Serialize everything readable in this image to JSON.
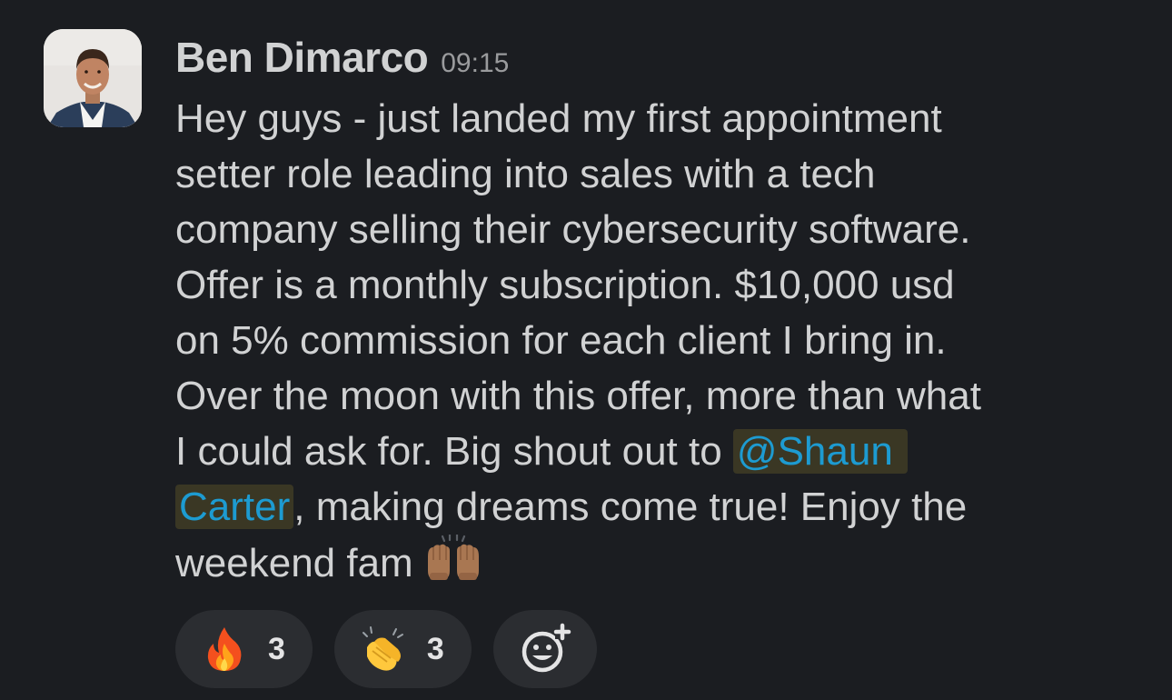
{
  "message": {
    "author": "Ben Dimarco",
    "time": "09:15",
    "text_before_mention": "Hey guys - just landed my first appointment\nsetter role leading into sales with a tech\ncompany selling their cybersecurity software.\nOffer is a monthly subscription. $10,000 usd\non 5% commission for each client I bring in.\nOver the moon with this offer, more than what\nI could ask for. Big shout out to ",
    "mention_part1": "@Shaun",
    "mention_part2": "Carter",
    "text_after_mention": ", making dreams come true! Enjoy the\nweekend fam ",
    "inline_emoji": "raising-hands-icon"
  },
  "reactions": [
    {
      "icon": "fire-icon",
      "count": "3"
    },
    {
      "icon": "clapping-hands-icon",
      "count": "3"
    }
  ],
  "add_reaction": {
    "icon": "add-reaction-icon"
  },
  "colors": {
    "background": "#1b1d21",
    "text": "#d1d2d3",
    "mention_text": "#1d9bd1",
    "mention_bg": "#3a3724",
    "reaction_pill": "#2b2d31"
  }
}
